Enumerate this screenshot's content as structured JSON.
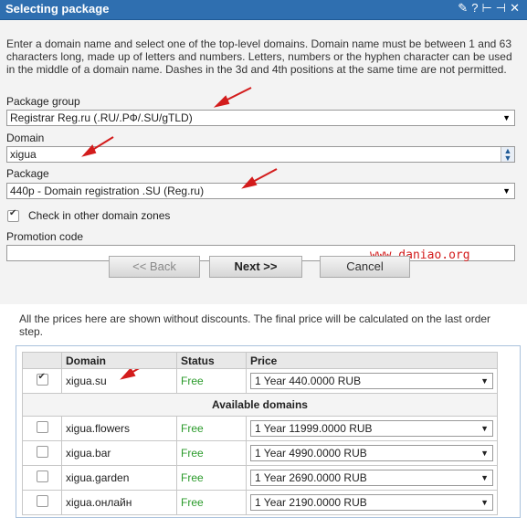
{
  "window": {
    "title": "Selecting package",
    "tools": [
      "✎",
      "?",
      "⊢⊣",
      "✕"
    ]
  },
  "intro_text": "Enter a domain name and select one of the top-level domains. Domain name must be between 1 and 63 characters long, made up of letters and numbers. Letters, numbers or the hyphen character can be used in the middle of a domain name. Dashes in the 3d and 4th positions at the same time are not permitted.",
  "form": {
    "package_group_label": "Package group",
    "package_group_value": "Registrar Reg.ru (.RU/.РФ/.SU/gTLD)",
    "domain_label": "Domain",
    "domain_value": "xigua",
    "package_label": "Package",
    "package_value": "440p - Domain registration .SU (Reg.ru)",
    "check_other_label": "Check in other domain zones",
    "promo_label": "Promotion code",
    "promo_value": ""
  },
  "watermark": "www.daniao.org",
  "buttons": {
    "back": "<< Back",
    "next": "Next >>",
    "cancel": "Cancel"
  },
  "notice": "All the prices here are shown without discounts. The final price will be calculated on the last order step.",
  "table": {
    "headers": [
      "",
      "Domain",
      "Status",
      "Price"
    ],
    "selected": {
      "domain": "xigua.su",
      "status": "Free",
      "price": "1 Year 440.0000 RUB",
      "checked": true
    },
    "available_header": "Available domains",
    "rows": [
      {
        "domain": "xigua.flowers",
        "status": "Free",
        "price": "1 Year 11999.0000 RUB"
      },
      {
        "domain": "xigua.bar",
        "status": "Free",
        "price": "1 Year 4990.0000 RUB"
      },
      {
        "domain": "xigua.garden",
        "status": "Free",
        "price": "1 Year 2690.0000 RUB"
      },
      {
        "domain": "xigua.онлайн",
        "status": "Free",
        "price": "1 Year 2190.0000 RUB"
      }
    ]
  },
  "colors": {
    "titlebar": "#2f6fb0",
    "free": "#2a9a2a",
    "annotation": "#d31c1c"
  }
}
